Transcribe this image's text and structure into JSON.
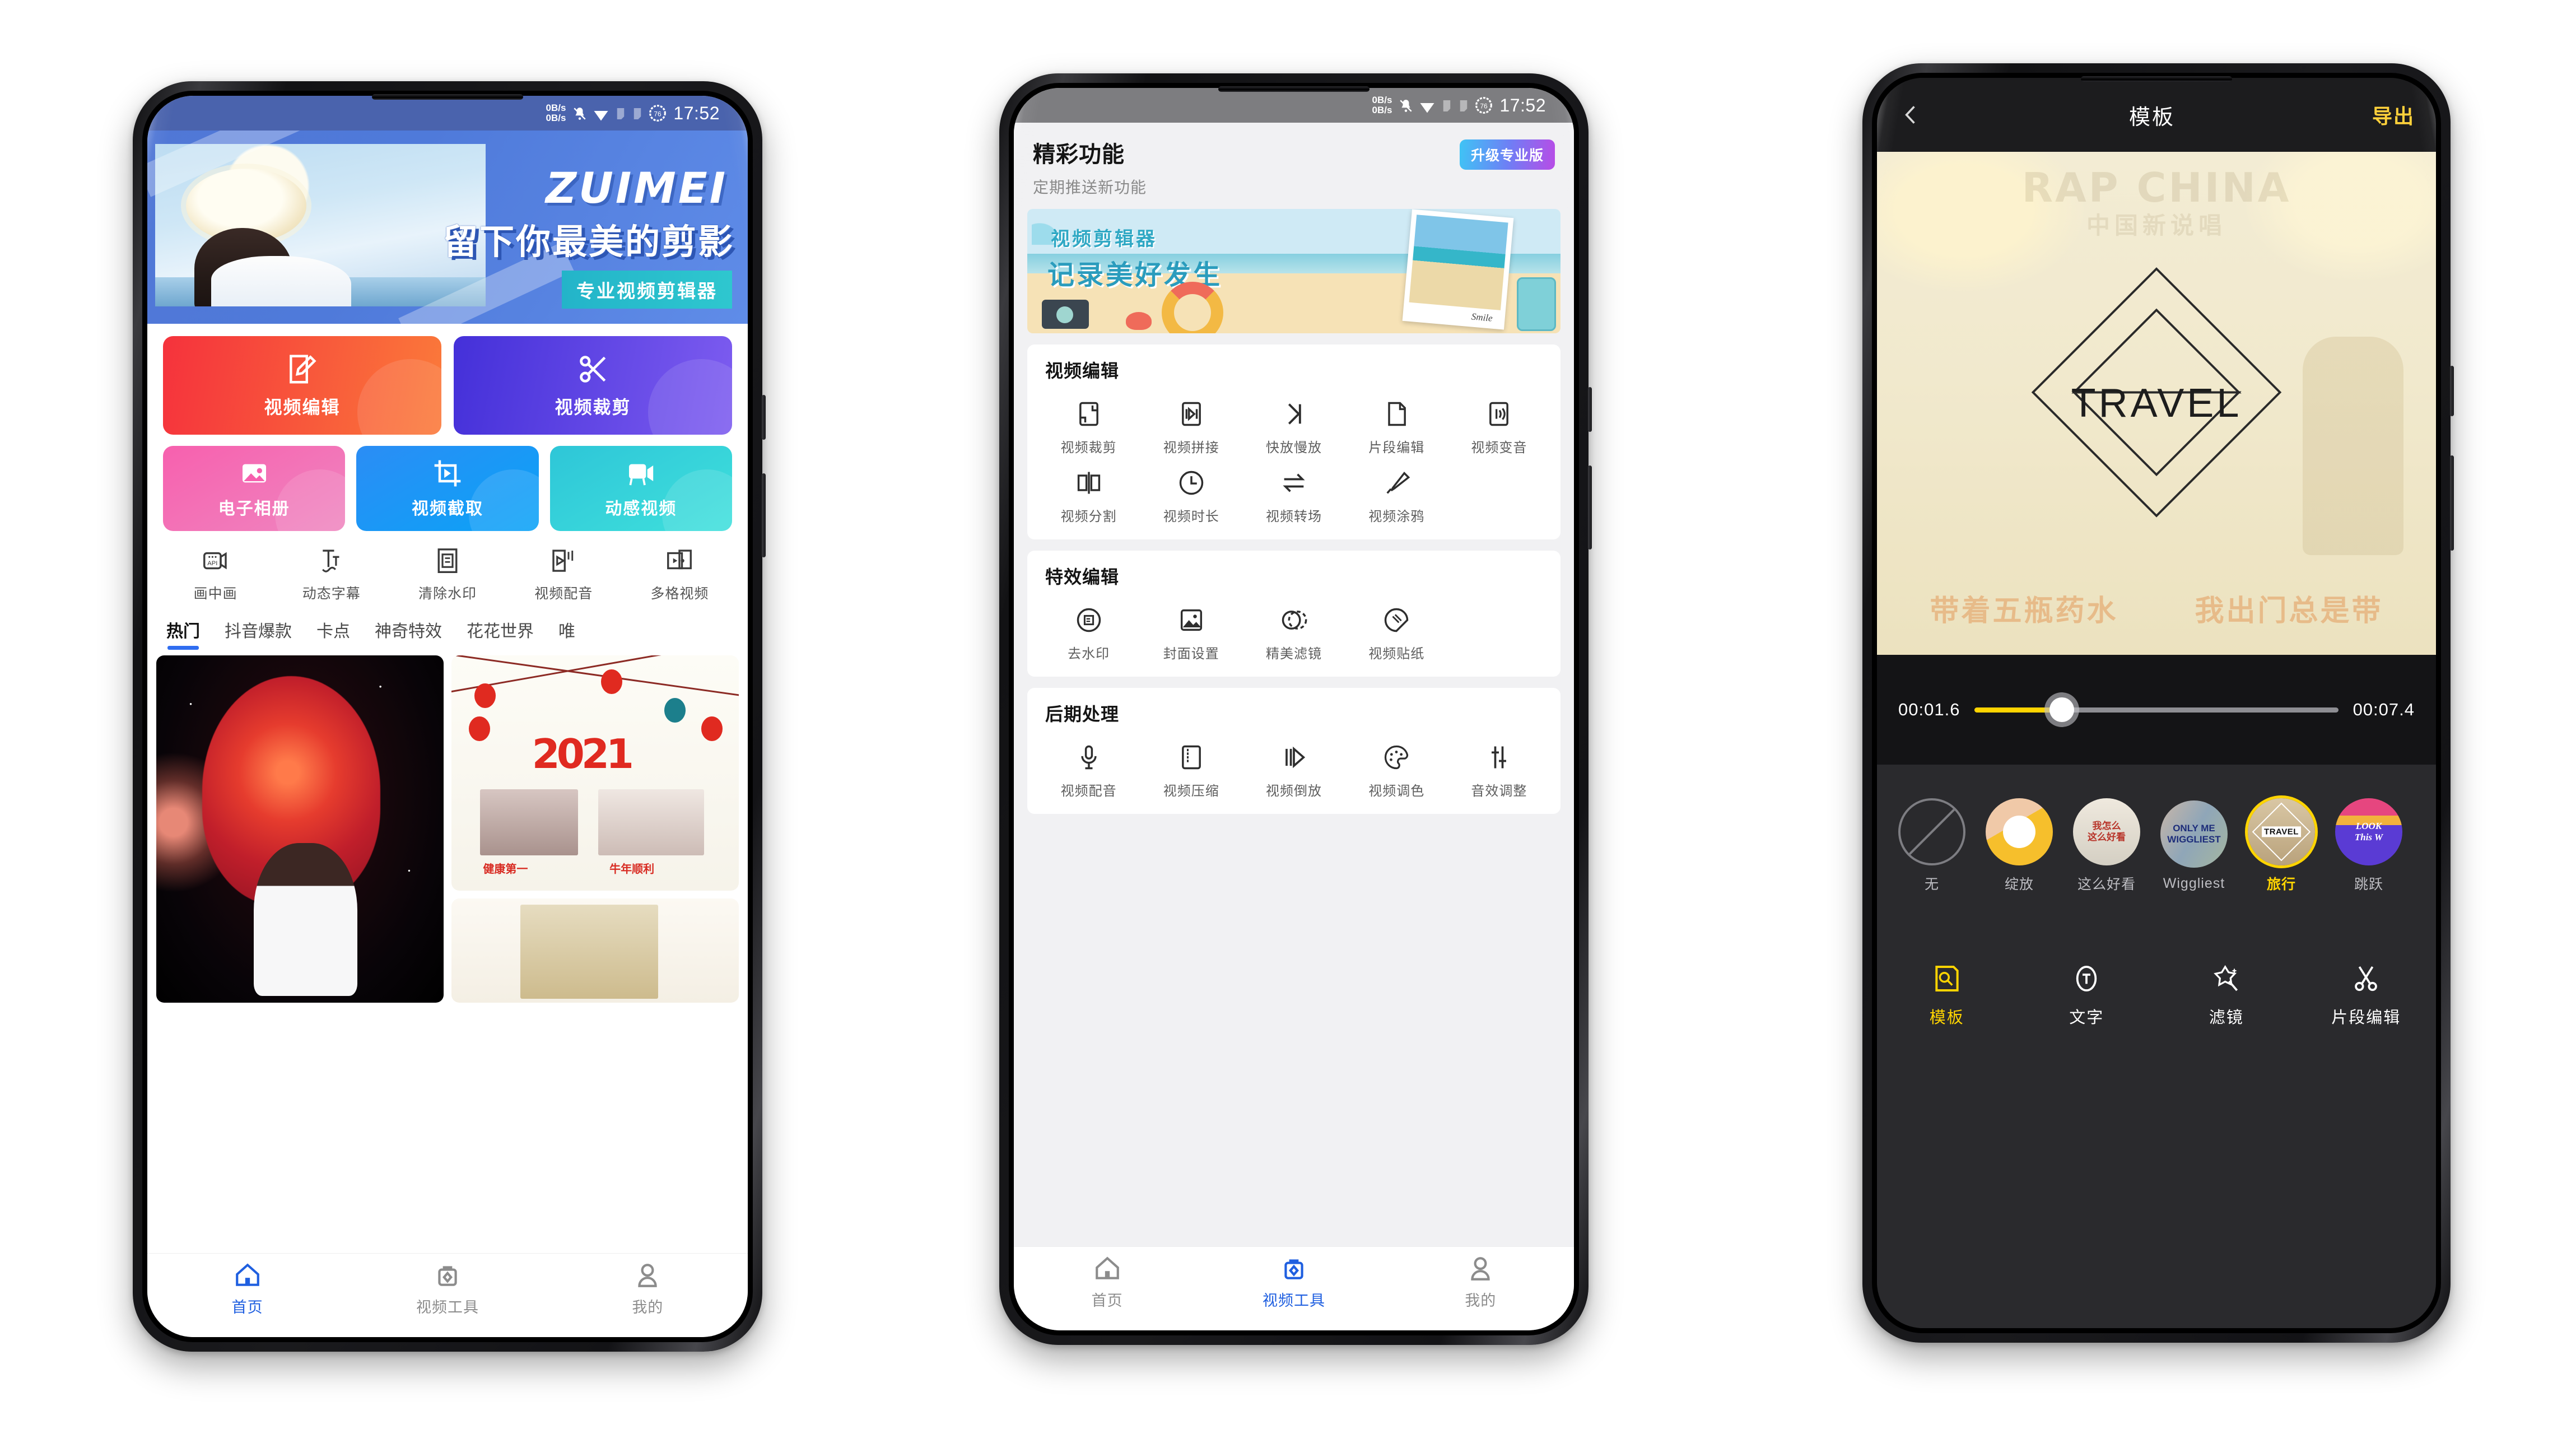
{
  "statusbar": {
    "speed_up": "0B/s",
    "speed_down": "0B/s",
    "battery": "76",
    "time": "17:52"
  },
  "phone1": {
    "banner": {
      "brand": "ZUIMEI",
      "slogan": "留下你最美的剪影",
      "tagline": "专业视频剪辑器"
    },
    "big_tiles": [
      {
        "label": "视频编辑",
        "icon": "edit-document-icon",
        "color_from": "#f5323c",
        "color_to": "#fb7a3a"
      },
      {
        "label": "视频裁剪",
        "icon": "scissors-icon",
        "color_from": "#4430d9",
        "color_to": "#7d5cf0"
      }
    ],
    "mid_tiles": [
      {
        "label": "电子相册",
        "icon": "photo-icon",
        "color_from": "#f760ae",
        "color_to": "#ef86c0"
      },
      {
        "label": "视频截取",
        "icon": "crop-play-icon",
        "color_from": "#2b8df5",
        "color_to": "#0aa3f7"
      },
      {
        "label": "动感视频",
        "icon": "video-camera-icon",
        "color_from": "#2ec6d8",
        "color_to": "#3fe0dc"
      }
    ],
    "small_tiles": [
      {
        "label": "画中画",
        "icon": "picture-in-picture-icon"
      },
      {
        "label": "动态字幕",
        "icon": "dynamic-subtitle-icon"
      },
      {
        "label": "清除水印",
        "icon": "remove-watermark-icon"
      },
      {
        "label": "视频配音",
        "icon": "video-dubbing-icon"
      },
      {
        "label": "多格视频",
        "icon": "multi-grid-video-icon"
      }
    ],
    "tabs": [
      {
        "label": "热门",
        "active": true
      },
      {
        "label": "抖音爆款",
        "active": false
      },
      {
        "label": "卡点",
        "active": false
      },
      {
        "label": "神奇特效",
        "active": false
      },
      {
        "label": "花花世界",
        "active": false
      },
      {
        "label": "唯",
        "active": false
      }
    ],
    "cards": {
      "new_year_year": "2021",
      "caption_left": "健康第一",
      "caption_right": "牛年顺利"
    },
    "nav": [
      {
        "label": "首页",
        "icon": "home-icon",
        "active": true
      },
      {
        "label": "视频工具",
        "icon": "toolbox-icon",
        "active": false
      },
      {
        "label": "我的",
        "icon": "person-icon",
        "active": false
      }
    ]
  },
  "phone2": {
    "header": {
      "title": "精彩功能",
      "subtitle": "定期推送新功能",
      "pro_button": "升级专业版"
    },
    "banner": {
      "line1": "视频剪辑器",
      "line2": "记录美好发生",
      "signature": "Smile"
    },
    "sections": [
      {
        "title": "视频编辑",
        "items": [
          {
            "label": "视频裁剪",
            "icon": "crop-icon"
          },
          {
            "label": "视频拼接",
            "icon": "splice-icon"
          },
          {
            "label": "快放慢放",
            "icon": "speed-icon"
          },
          {
            "label": "片段编辑",
            "icon": "clip-edit-icon"
          },
          {
            "label": "视频变音",
            "icon": "voice-change-icon"
          },
          {
            "label": "视频分割",
            "icon": "split-icon"
          },
          {
            "label": "视频时长",
            "icon": "clock-icon"
          },
          {
            "label": "视频转场",
            "icon": "transition-icon"
          },
          {
            "label": "视频涂鸦",
            "icon": "brush-icon"
          }
        ]
      },
      {
        "title": "特效编辑",
        "items": [
          {
            "label": "去水印",
            "icon": "remove-watermark-icon"
          },
          {
            "label": "封面设置",
            "icon": "cover-image-icon"
          },
          {
            "label": "精美滤镜",
            "icon": "filter-icon"
          },
          {
            "label": "视频贴纸",
            "icon": "sticker-icon"
          }
        ]
      },
      {
        "title": "后期处理",
        "items": [
          {
            "label": "视频配音",
            "icon": "microphone-icon"
          },
          {
            "label": "视频压缩",
            "icon": "compress-icon"
          },
          {
            "label": "视频倒放",
            "icon": "reverse-play-icon"
          },
          {
            "label": "视频调色",
            "icon": "palette-icon"
          },
          {
            "label": "音效调整",
            "icon": "sliders-icon"
          }
        ]
      }
    ],
    "nav": [
      {
        "label": "首页",
        "icon": "home-icon",
        "active": false
      },
      {
        "label": "视频工具",
        "icon": "toolbox-icon",
        "active": true
      },
      {
        "label": "我的",
        "icon": "person-icon",
        "active": false
      }
    ]
  },
  "phone3": {
    "topbar": {
      "back_icon": "chevron-left-icon",
      "title": "模板",
      "export": "导出"
    },
    "preview": {
      "overlay_text": "TRAVEL",
      "watermark": "RAP CHINA",
      "watermark_sub": "中国新说唱",
      "subtitle_left": "带着五瓶药水",
      "subtitle_right": "我出门总是带"
    },
    "timeline": {
      "current": "00:01.6",
      "total": "00:07.4",
      "progress_pct": 24,
      "accent": "#ffd400"
    },
    "templates": [
      {
        "label": "无",
        "selected": false,
        "thumb_text": ""
      },
      {
        "label": "绽放",
        "selected": false,
        "thumb_text": ""
      },
      {
        "label": "这么好看",
        "selected": false,
        "thumb_text": "我怎么\n这么好看"
      },
      {
        "label": "Wiggliest",
        "selected": false,
        "thumb_text": "ONLY ME\nWIGGLIEST"
      },
      {
        "label": "旅行",
        "selected": true,
        "thumb_text": "TRAVEL"
      },
      {
        "label": "跳跃",
        "selected": false,
        "thumb_text": "LOOK\nThis W"
      }
    ],
    "tools": [
      {
        "label": "模板",
        "icon": "template-icon",
        "active": true
      },
      {
        "label": "文字",
        "icon": "text-icon",
        "active": false
      },
      {
        "label": "滤镜",
        "icon": "magic-wand-icon",
        "active": false
      },
      {
        "label": "片段编辑",
        "icon": "scissors-icon",
        "active": false
      }
    ]
  }
}
